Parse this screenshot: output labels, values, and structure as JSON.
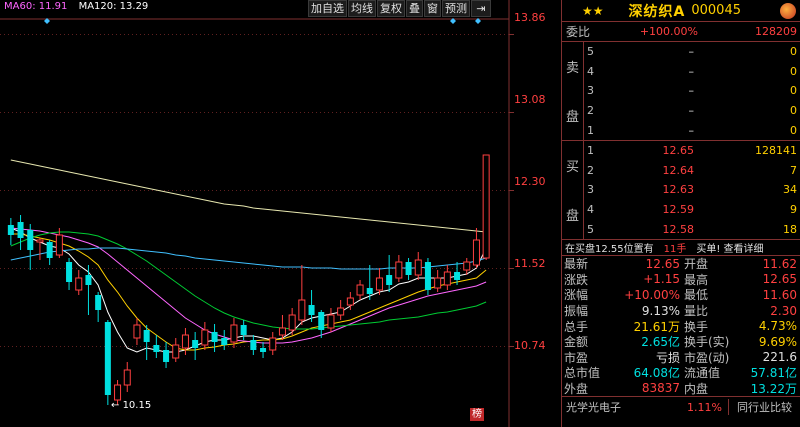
{
  "legend": {
    "ma60": "MA60: 11.91",
    "ma120": "MA120: 13.29"
  },
  "toolbar": [
    "加自选",
    "均线",
    "复权",
    "叠",
    "窗",
    "预测",
    "⇥"
  ],
  "price_axis": [
    "13.86",
    "13.08",
    "12.30",
    "11.52",
    "10.74"
  ],
  "low_marker": "10.15",
  "rank_badge": "榜",
  "colors": {
    "up": "#ff4040",
    "down": "#00e0e0",
    "ma5": "#ffffff",
    "ma10": "#ffd000",
    "ma20": "#ff66ff",
    "ma30": "#00cc33",
    "ma60": "#40c0ff",
    "ma120": "#e8e8b0"
  },
  "chart_data": {
    "type": "candlestick",
    "ylim": [
      10.0,
      14.0
    ],
    "low_label": 10.15,
    "candles": [
      {
        "o": 11.95,
        "c": 11.85,
        "h": 12.02,
        "l": 11.75
      },
      {
        "o": 11.98,
        "c": 11.82,
        "h": 12.05,
        "l": 11.7
      },
      {
        "o": 11.9,
        "c": 11.7,
        "h": 11.96,
        "l": 11.5
      },
      {
        "o": 11.78,
        "c": 11.8,
        "h": 11.82,
        "l": 11.6
      },
      {
        "o": 11.78,
        "c": 11.62,
        "h": 11.8,
        "l": 11.55
      },
      {
        "o": 11.65,
        "c": 11.85,
        "h": 11.92,
        "l": 11.62
      },
      {
        "o": 11.58,
        "c": 11.38,
        "h": 11.62,
        "l": 11.3
      },
      {
        "o": 11.3,
        "c": 11.42,
        "h": 11.5,
        "l": 11.25
      },
      {
        "o": 11.45,
        "c": 11.35,
        "h": 11.55,
        "l": 11.05
      },
      {
        "o": 11.25,
        "c": 11.1,
        "h": 11.28,
        "l": 10.98
      },
      {
        "o": 10.98,
        "c": 10.25,
        "h": 11.0,
        "l": 10.15
      },
      {
        "o": 10.2,
        "c": 10.35,
        "h": 10.4,
        "l": 10.15
      },
      {
        "o": 10.35,
        "c": 10.5,
        "h": 10.58,
        "l": 10.28
      },
      {
        "o": 10.82,
        "c": 10.95,
        "h": 11.02,
        "l": 10.75
      },
      {
        "o": 10.9,
        "c": 10.78,
        "h": 10.95,
        "l": 10.6
      },
      {
        "o": 10.75,
        "c": 10.68,
        "h": 10.85,
        "l": 10.62
      },
      {
        "o": 10.7,
        "c": 10.58,
        "h": 10.78,
        "l": 10.52
      },
      {
        "o": 10.62,
        "c": 10.75,
        "h": 10.82,
        "l": 10.58
      },
      {
        "o": 10.72,
        "c": 10.85,
        "h": 10.92,
        "l": 10.65
      },
      {
        "o": 10.8,
        "c": 10.72,
        "h": 10.88,
        "l": 10.6
      },
      {
        "o": 10.75,
        "c": 10.9,
        "h": 10.98,
        "l": 10.7
      },
      {
        "o": 10.88,
        "c": 10.78,
        "h": 10.96,
        "l": 10.68
      },
      {
        "o": 10.82,
        "c": 10.75,
        "h": 10.9,
        "l": 10.7
      },
      {
        "o": 10.78,
        "c": 10.95,
        "h": 11.02,
        "l": 10.72
      },
      {
        "o": 10.95,
        "c": 10.85,
        "h": 11.0,
        "l": 10.8
      },
      {
        "o": 10.8,
        "c": 10.7,
        "h": 10.85,
        "l": 10.65
      },
      {
        "o": 10.72,
        "c": 10.68,
        "h": 10.78,
        "l": 10.62
      },
      {
        "o": 10.7,
        "c": 10.82,
        "h": 10.88,
        "l": 10.65
      },
      {
        "o": 10.85,
        "c": 10.92,
        "h": 11.05,
        "l": 10.8
      },
      {
        "o": 10.9,
        "c": 11.05,
        "h": 11.12,
        "l": 10.85
      },
      {
        "o": 11.0,
        "c": 11.2,
        "h": 11.55,
        "l": 10.95
      },
      {
        "o": 11.15,
        "c": 11.05,
        "h": 11.3,
        "l": 10.98
      },
      {
        "o": 11.08,
        "c": 10.9,
        "h": 11.1,
        "l": 10.82
      },
      {
        "o": 10.92,
        "c": 11.05,
        "h": 11.12,
        "l": 10.88
      },
      {
        "o": 11.05,
        "c": 11.12,
        "h": 11.2,
        "l": 11.0
      },
      {
        "o": 11.15,
        "c": 11.22,
        "h": 11.28,
        "l": 11.1
      },
      {
        "o": 11.25,
        "c": 11.35,
        "h": 11.4,
        "l": 11.2
      },
      {
        "o": 11.32,
        "c": 11.26,
        "h": 11.55,
        "l": 11.2
      },
      {
        "o": 11.3,
        "c": 11.42,
        "h": 11.52,
        "l": 11.25
      },
      {
        "o": 11.45,
        "c": 11.35,
        "h": 11.65,
        "l": 11.28
      },
      {
        "o": 11.42,
        "c": 11.58,
        "h": 11.65,
        "l": 11.38
      },
      {
        "o": 11.58,
        "c": 11.45,
        "h": 11.62,
        "l": 11.4
      },
      {
        "o": 11.45,
        "c": 11.6,
        "h": 11.68,
        "l": 11.4
      },
      {
        "o": 11.58,
        "c": 11.3,
        "h": 11.62,
        "l": 11.25
      },
      {
        "o": 11.32,
        "c": 11.42,
        "h": 11.5,
        "l": 11.28
      },
      {
        "o": 11.35,
        "c": 11.48,
        "h": 11.55,
        "l": 11.3
      },
      {
        "o": 11.48,
        "c": 11.4,
        "h": 11.58,
        "l": 11.35
      },
      {
        "o": 11.5,
        "c": 11.58,
        "h": 11.62,
        "l": 11.45
      },
      {
        "o": 11.55,
        "c": 11.8,
        "h": 11.92,
        "l": 11.52
      },
      {
        "o": 11.62,
        "c": 12.65,
        "h": 12.65,
        "l": 11.6
      }
    ],
    "ma_lines": [
      {
        "name": "MA5",
        "values": [
          11.92,
          11.88,
          11.82,
          11.78,
          11.74,
          11.72,
          11.66,
          11.55,
          11.48,
          11.35,
          11.08,
          10.88,
          10.72,
          10.68,
          10.72,
          10.7,
          10.68,
          10.68,
          10.7,
          10.74,
          10.78,
          10.8,
          10.8,
          10.82,
          10.84,
          10.84,
          10.82,
          10.8,
          10.82,
          10.88,
          10.98,
          11.02,
          11.04,
          11.06,
          11.08,
          11.14,
          11.2,
          11.24,
          11.28,
          11.3,
          11.36,
          11.38,
          11.42,
          11.42,
          11.42,
          11.42,
          11.44,
          11.46,
          11.52,
          11.72
        ]
      },
      {
        "name": "MA10",
        "values": [
          11.86,
          11.86,
          11.84,
          11.82,
          11.8,
          11.77,
          11.74,
          11.69,
          11.63,
          11.55,
          11.4,
          11.28,
          11.14,
          11.02,
          10.92,
          10.85,
          10.78,
          10.72,
          10.7,
          10.7,
          10.72,
          10.73,
          10.75,
          10.76,
          10.78,
          10.79,
          10.8,
          10.8,
          10.81,
          10.84,
          10.88,
          10.92,
          10.94,
          10.96,
          10.98,
          11.0,
          11.04,
          11.08,
          11.12,
          11.16,
          11.2,
          11.24,
          11.28,
          11.31,
          11.34,
          11.36,
          11.38,
          11.4,
          11.42,
          11.5
        ]
      },
      {
        "name": "MA20",
        "values": [
          11.92,
          11.91,
          11.9,
          11.89,
          11.87,
          11.85,
          11.83,
          11.8,
          11.77,
          11.73,
          11.66,
          11.58,
          11.5,
          11.42,
          11.34,
          11.26,
          11.18,
          11.1,
          11.02,
          10.96,
          10.9,
          10.86,
          10.83,
          10.8,
          10.79,
          10.78,
          10.77,
          10.77,
          10.77,
          10.78,
          10.8,
          10.82,
          10.85,
          10.88,
          10.92,
          10.96,
          11.0,
          11.04,
          11.08,
          11.12,
          11.15,
          11.18,
          11.21,
          11.24,
          11.26,
          11.28,
          11.3,
          11.32,
          11.34,
          11.38
        ]
      },
      {
        "name": "MA30",
        "values": [
          11.74,
          11.78,
          11.82,
          11.85,
          11.87,
          11.88,
          11.88,
          11.87,
          11.86,
          11.84,
          11.8,
          11.76,
          11.71,
          11.65,
          11.59,
          11.52,
          11.45,
          11.38,
          11.31,
          11.24,
          11.18,
          11.12,
          11.07,
          11.03,
          11.0,
          10.97,
          10.95,
          10.93,
          10.92,
          10.91,
          10.91,
          10.91,
          10.92,
          10.93,
          10.94,
          10.95,
          10.96,
          10.97,
          10.98,
          11.0,
          11.01,
          11.02,
          11.03,
          11.05,
          11.07,
          11.08,
          11.1,
          11.12,
          11.14,
          11.18
        ]
      },
      {
        "name": "MA60",
        "values": [
          11.6,
          11.62,
          11.64,
          11.66,
          11.68,
          11.69,
          11.7,
          11.71,
          11.71,
          11.72,
          11.72,
          11.72,
          11.71,
          11.7,
          11.69,
          11.68,
          11.67,
          11.65,
          11.64,
          11.62,
          11.61,
          11.6,
          11.59,
          11.58,
          11.57,
          11.56,
          11.55,
          11.54,
          11.53,
          11.53,
          11.53,
          11.52,
          11.52,
          11.52,
          11.51,
          11.51,
          11.51,
          11.51,
          11.51,
          11.52,
          11.52,
          11.52,
          11.52,
          11.53,
          11.54,
          11.55,
          11.56,
          11.57,
          11.59,
          11.62
        ]
      },
      {
        "name": "MA120",
        "values": [
          12.6,
          12.58,
          12.56,
          12.54,
          12.52,
          12.5,
          12.48,
          12.46,
          12.44,
          12.42,
          12.4,
          12.38,
          12.36,
          12.34,
          12.32,
          12.3,
          12.28,
          12.26,
          12.24,
          12.22,
          12.2,
          12.18,
          12.16,
          12.15,
          12.14,
          12.12,
          12.11,
          12.1,
          12.09,
          12.08,
          12.07,
          12.06,
          12.05,
          12.04,
          12.03,
          12.02,
          12.01,
          12.0,
          11.99,
          11.98,
          11.97,
          11.96,
          11.95,
          11.94,
          11.93,
          11.92,
          11.91,
          11.9,
          11.89,
          11.88
        ]
      }
    ]
  },
  "stock": {
    "stars": "★★",
    "name": "深纺织A",
    "code": "000045"
  },
  "weibi": {
    "label": "委比",
    "pct": "+100.00%",
    "diff": "128209"
  },
  "sell_label": "卖盘",
  "buy_label": "买盘",
  "sell_book": [
    {
      "lvl": "5",
      "px": "–",
      "vol": "0"
    },
    {
      "lvl": "4",
      "px": "–",
      "vol": "0"
    },
    {
      "lvl": "3",
      "px": "–",
      "vol": "0"
    },
    {
      "lvl": "2",
      "px": "–",
      "vol": "0"
    },
    {
      "lvl": "1",
      "px": "–",
      "vol": "0"
    }
  ],
  "buy_book": [
    {
      "lvl": "1",
      "px": "12.65",
      "vol": "128141"
    },
    {
      "lvl": "2",
      "px": "12.64",
      "vol": "7"
    },
    {
      "lvl": "3",
      "px": "12.63",
      "vol": "34"
    },
    {
      "lvl": "4",
      "px": "12.59",
      "vol": "9"
    },
    {
      "lvl": "5",
      "px": "12.58",
      "vol": "18"
    }
  ],
  "notice": {
    "n1": "在买盘12.55位置有",
    "n2": "11手",
    "n3": "买单! 查看详细"
  },
  "stats": [
    {
      "k": "最新",
      "v": "12.65",
      "vc": "red",
      "k2": "开盘",
      "v2": "11.62",
      "v2c": "red"
    },
    {
      "k": "涨跌",
      "v": "+1.15",
      "vc": "red",
      "k2": "最高",
      "v2": "12.65",
      "v2c": "red"
    },
    {
      "k": "涨幅",
      "v": "+10.00%",
      "vc": "red",
      "k2": "最低",
      "v2": "11.60",
      "v2c": "red"
    },
    {
      "k": "振幅",
      "v": "9.13%",
      "vc": "white",
      "k2": "量比",
      "v2": "2.30",
      "v2c": "red"
    },
    {
      "k": "总手",
      "v": "21.61万",
      "vc": "yellow",
      "k2": "换手",
      "v2": "4.73%",
      "v2c": "yellow"
    },
    {
      "k": "金额",
      "v": "2.65亿",
      "vc": "green",
      "k2": "换手(实)",
      "v2": "9.69%",
      "v2c": "yellow"
    },
    {
      "k": "市盈",
      "v": "亏损",
      "vc": "white",
      "k2": "市盈(动)",
      "v2": "221.6",
      "v2c": "white"
    },
    {
      "k": "总市值",
      "v": "64.08亿",
      "vc": "green",
      "k2": "流通值",
      "v2": "57.81亿",
      "v2c": "green"
    },
    {
      "k": "外盘",
      "v": "83837",
      "vc": "red",
      "k2": "内盘",
      "v2": "13.22万",
      "v2c": "green"
    }
  ],
  "industry": {
    "name": "光学光电子",
    "pct": "1.11%",
    "button": "同行业比较"
  }
}
